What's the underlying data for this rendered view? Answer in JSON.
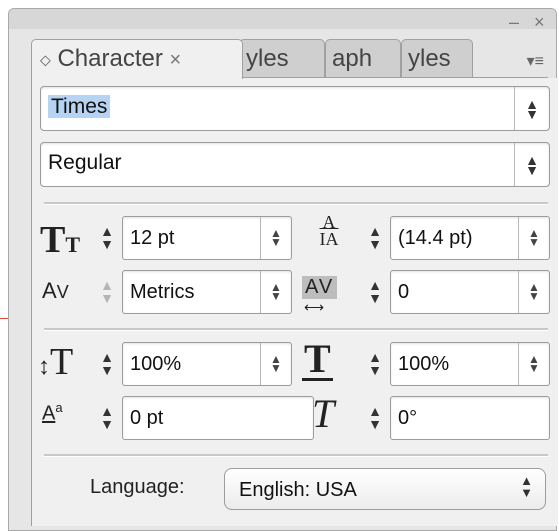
{
  "tabs": [
    {
      "label": "Character",
      "icon": "updown-icon",
      "close": "×"
    },
    {
      "label": "yles"
    },
    {
      "label": "aph"
    },
    {
      "label": "yles"
    }
  ],
  "font_family": {
    "value": "Times"
  },
  "font_style": {
    "value": "Regular"
  },
  "font_size": {
    "value": "12 pt"
  },
  "leading": {
    "value": "(14.4 pt)"
  },
  "kerning": {
    "value": "Metrics"
  },
  "tracking": {
    "value": "0"
  },
  "vertical_scale": {
    "value": "100%"
  },
  "horizontal_scale": {
    "value": "100%"
  },
  "baseline_shift": {
    "value": "0 pt"
  },
  "skew": {
    "value": "0°"
  },
  "language": {
    "label": "Language:",
    "value": "English: USA"
  },
  "colors": {
    "panel_bg": "#f0f0f0",
    "selection": "#b6d3f3",
    "pointer_arrow": "#d94a38"
  }
}
